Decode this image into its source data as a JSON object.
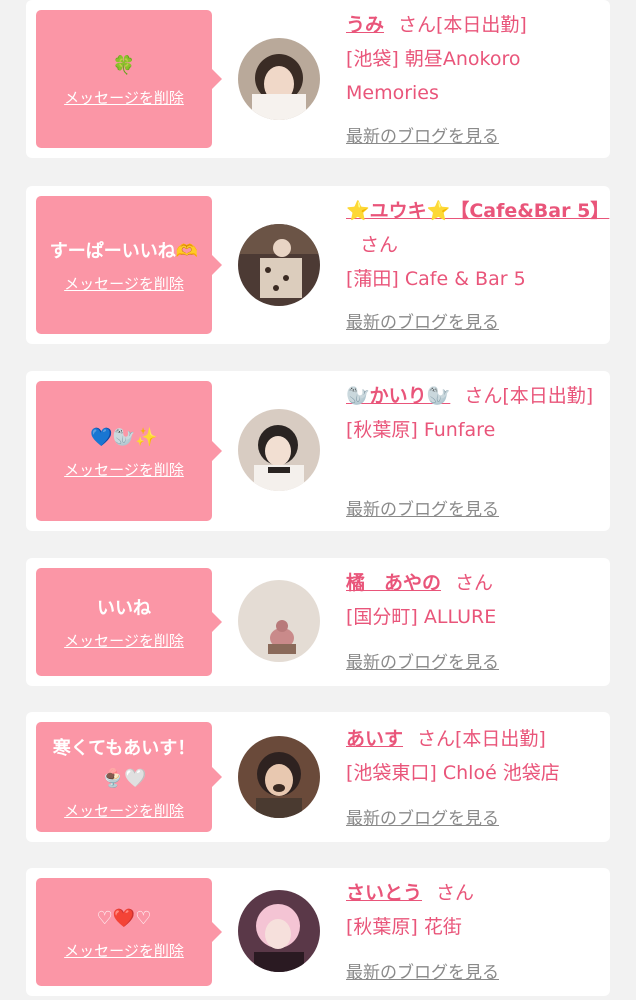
{
  "delete_label": "メッセージを削除",
  "blog_label": "最新のブログを見る",
  "colors": {
    "bubble": "#fb96a6",
    "accent": "#e9557a",
    "blog_link": "#8a8a8a",
    "background": "#f2f2f2"
  },
  "cards": [
    {
      "message": "🍀",
      "name": "うみ",
      "san": "さん[本日出勤]",
      "shop": "[池袋] 朝昼Anokoro Memories"
    },
    {
      "message": "すーぱーいいね🫶",
      "name": "⭐ユウキ⭐【Cafe&Bar 5】",
      "san": "さん",
      "shop": "[蒲田] Cafe & Bar 5"
    },
    {
      "message": "💙🦭✨",
      "name": "🦭かいり🦭",
      "san": "さん[本日出勤]",
      "shop": "[秋葉原] Funfare"
    },
    {
      "message": "いいね",
      "name": "橘　あやの",
      "san": "さん",
      "shop": "[国分町] ALLURE"
    },
    {
      "message": "寒くてもあいす！🍨🤍",
      "name": "あいす",
      "san": "さん[本日出勤]",
      "shop": "[池袋東口] Chloé 池袋店"
    },
    {
      "message": "♡❤️♡",
      "name": "さいとう",
      "san": "さん",
      "shop": "[秋葉原] 花街"
    }
  ]
}
